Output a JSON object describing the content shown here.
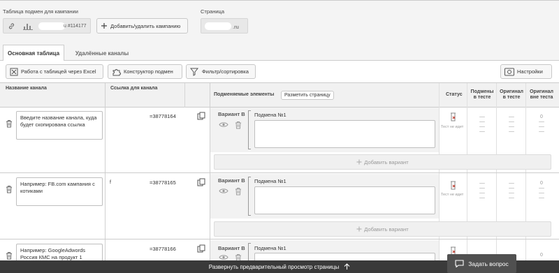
{
  "header": {
    "campaign_table_label": "Таблица подмен для кампании",
    "campaign_id": "u #114177",
    "add_campaign_button": "Добавить/удалить кампанию",
    "page_label": "Страница",
    "page_domain": ".ru"
  },
  "tabs": [
    {
      "label": "Основная таблица",
      "active": true
    },
    {
      "label": "Удалённые каналы",
      "active": false
    }
  ],
  "toolbar": {
    "excel_button": "Работа с таблицей через Excel",
    "constructor_button": "Конструктор подмен",
    "filter_button": "Фильтр/сортировка",
    "settings_button": "Настройки"
  },
  "columns": {
    "channel_name": "Название канала",
    "channel_link": "Ссылка для канала",
    "replaced_elements": "Подменяемые элементы",
    "markup_button": "Разметить страницу",
    "status": "Статус",
    "subs_in_test_l1": "Подмены",
    "subs_in_test_l2": "в тесте",
    "orig_in_test_l1": "Оригинал",
    "orig_in_test_l2": "в тесте",
    "orig_out_test_l1": "Оригинал",
    "orig_out_test_l2": "вне теста"
  },
  "rows": [
    {
      "placeholder": "Введите название канала, куда будет скопирована ссылка",
      "link_suffix": "=38778164",
      "variant": "Вариант B",
      "substitution": "Подмена №1",
      "status": "Тест не идет"
    },
    {
      "placeholder": "Например: FB.com кампания с котиками",
      "link_prefix": "f",
      "link_suffix": "=38778165",
      "variant": "Вариант B",
      "substitution": "Подмена №1",
      "status": "Тест не идет"
    },
    {
      "placeholder": "Например: GoogleAdwords Россия КМС на продукт 1",
      "link_suffix": "=38778166",
      "variant": "Вариант B",
      "substitution": "Подмена №1",
      "status": ""
    }
  ],
  "add_variant_label": "Добавить вариант",
  "footer": {
    "expand_preview": "Развернуть предварительный просмотр страницы",
    "ask_question": "Задать вопрос"
  },
  "colors": {
    "accent_status": "#c0392b",
    "footer_bg": "#3a3a3a"
  }
}
